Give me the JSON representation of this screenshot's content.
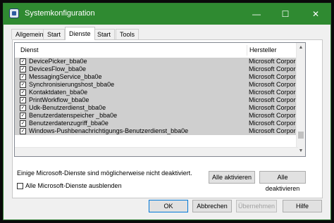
{
  "window": {
    "title": "Systemkonfiguration"
  },
  "titlebar": {
    "minimize": "—",
    "maximize": "☐",
    "close": "✕"
  },
  "tabs": [
    {
      "label": "Allgemein",
      "active": false
    },
    {
      "label": "Start",
      "active": false
    },
    {
      "label": "Dienste",
      "active": true
    },
    {
      "label": "Start",
      "active": false
    },
    {
      "label": "Tools",
      "active": false
    }
  ],
  "table": {
    "headers": {
      "service": "Dienst",
      "manufacturer": "Hersteller"
    },
    "rows": [
      {
        "name": "DevicePicker_bba0e",
        "manufacturer": "Microsoft Corporation",
        "checked": true
      },
      {
        "name": "DevicesFlow_bba0e",
        "manufacturer": "Microsoft Corporation",
        "checked": true
      },
      {
        "name": "MessagingService_bba0e",
        "manufacturer": "Microsoft Corporation",
        "checked": true
      },
      {
        "name": "Synchronisierungshost_bba0e",
        "manufacturer": "Microsoft Corporation",
        "checked": true
      },
      {
        "name": "Kontaktdaten_bba0e",
        "manufacturer": "Microsoft Corporation",
        "checked": true
      },
      {
        "name": "PrintWorkflow_bba0e",
        "manufacturer": "Microsoft Corporation",
        "checked": true
      },
      {
        "name": "Udk-Benutzerdienst_bba0e",
        "manufacturer": "Microsoft Corporation",
        "checked": true
      },
      {
        "name": "Benutzerdatenspeicher _bba0e",
        "manufacturer": "Microsoft Corporation",
        "checked": true
      },
      {
        "name": "Benutzerdatenzugriff_bba0e",
        "manufacturer": "Microsoft Corporation",
        "checked": true
      },
      {
        "name": "Windows-Pushbenachrichtigungs-Benutzerdienst_bba0e",
        "manufacturer": "Microsoft Corporation",
        "checked": true
      }
    ]
  },
  "note": "Einige Microsoft-Dienste sind möglicherweise nicht deaktiviert.",
  "buttons": {
    "enable_all": "Alle aktivieren",
    "disable_all": "Alle deaktivieren",
    "ok": "OK",
    "cancel": "Abbrechen",
    "apply": "Übernehmen",
    "help": "Hilfe"
  },
  "hide_ms": {
    "label": "Alle Microsoft-Dienste ausblenden",
    "checked": false
  },
  "colors": {
    "titlebar": "#2f8a31",
    "row_bg": "#cfcfcf",
    "accent": "#0078d7"
  }
}
